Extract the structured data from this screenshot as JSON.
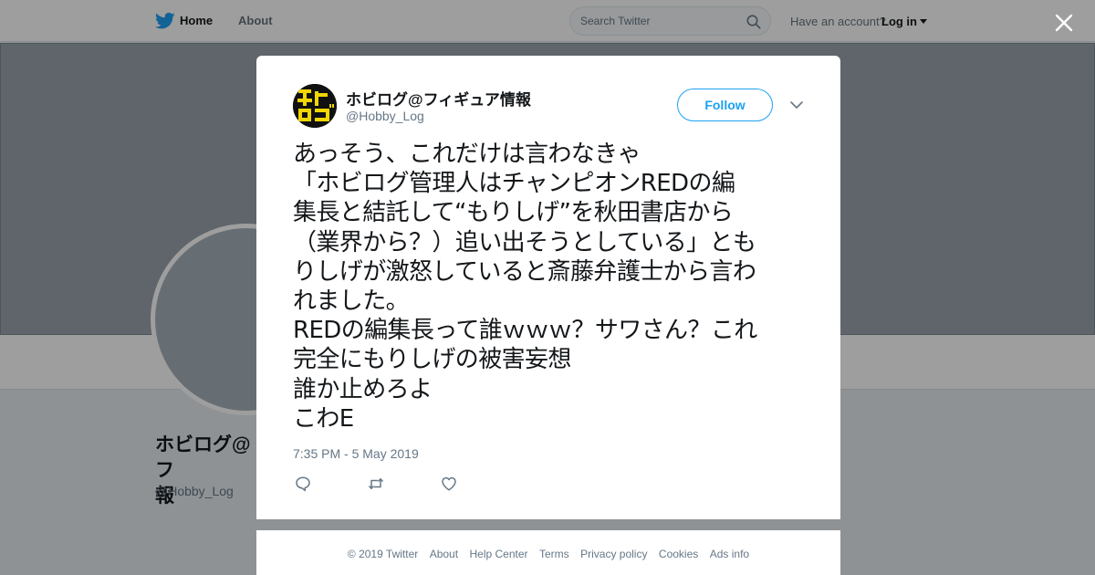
{
  "nav": {
    "home_label": "Home",
    "about_label": "About",
    "search_placeholder": "Search Twitter",
    "account_prompt": "Have an account?",
    "login_label": "Log in"
  },
  "profile": {
    "name": "ホビログ@フィギュア情報",
    "name_visible": "ホビログ@フ\n報",
    "handle": "@Hobby_Log"
  },
  "tweet": {
    "display_name": "ホビログ@フィギュア情報",
    "screen_name": "@Hobby_Log",
    "follow_label": "Follow",
    "text": "あっそう、これだけは言わなきゃ\n「ホビログ管理人はチャンピオンREDの編\n集長と結託して“もりしげ”を秋田書店から\n（業界から？）追い出そうとしている」とも\nりしげが激怒していると斎藤弁護士から言わ\nれました。\nREDの編集長って誰ｗｗｗ？サワさん？これ\n完全にもりしげの被害妄想\n誰か止めろよ\nこわE",
    "timestamp": "7:35 PM - 5 May 2019"
  },
  "footer": {
    "copyright": "© 2019 Twitter",
    "links": [
      "About",
      "Help Center",
      "Terms",
      "Privacy policy",
      "Cookies",
      "Ads info"
    ]
  },
  "colors": {
    "brand_blue": "#1da1f2",
    "text_primary": "#14171a",
    "text_secondary": "#657786",
    "avatar_yellow": "#f2d600"
  },
  "icons": [
    "twitter-bird-icon",
    "search-icon",
    "caret-down-icon",
    "close-icon",
    "chevron-down-icon",
    "reply-icon",
    "retweet-icon",
    "like-icon"
  ]
}
